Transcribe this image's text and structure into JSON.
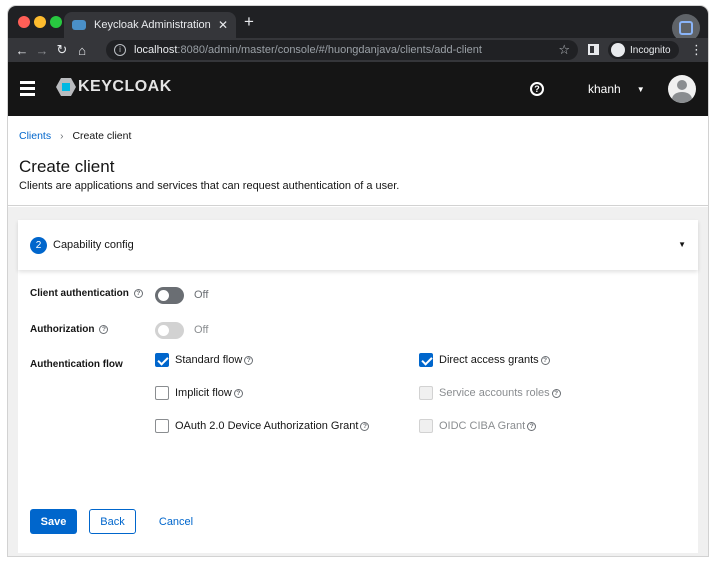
{
  "browser": {
    "tab_title": "Keycloak Administration Conso",
    "url_host": "localhost",
    "url_rest": ":8080/admin/master/console/#/huongdanjava/clients/add-client",
    "incognito_label": "Incognito"
  },
  "masthead": {
    "logo_text": "KEYCLOAK",
    "username": "khanh"
  },
  "breadcrumb": {
    "parent": "Clients",
    "current": "Create client"
  },
  "page": {
    "title": "Create client",
    "description": "Clients are applications and services that can request authentication of a user."
  },
  "step": {
    "number": "2",
    "label": "Capability config"
  },
  "fields": {
    "client_authentication": {
      "label": "Client authentication",
      "state": "Off"
    },
    "authorization": {
      "label": "Authorization",
      "state": "Off"
    },
    "authentication_flow": {
      "label": "Authentication flow"
    }
  },
  "flows": {
    "standard_flow": "Standard flow",
    "direct_access_grants": "Direct access grants",
    "implicit_flow": "Implicit flow",
    "service_accounts_roles": "Service accounts roles",
    "device_grant": "OAuth 2.0 Device Authorization Grant",
    "oidc_ciba_grant": "OIDC CIBA Grant"
  },
  "buttons": {
    "save": "Save",
    "back": "Back",
    "cancel": "Cancel"
  },
  "colors": {
    "accent": "#0066cc",
    "masthead": "#151515"
  }
}
